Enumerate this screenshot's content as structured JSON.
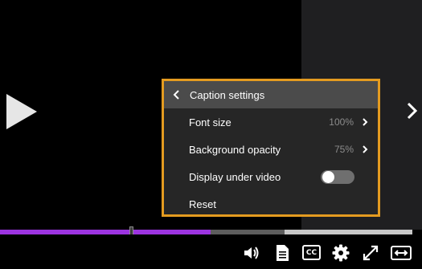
{
  "caption_menu": {
    "title": "Caption settings",
    "items": [
      {
        "label": "Font size",
        "value": "100%"
      },
      {
        "label": "Background opacity",
        "value": "75%"
      }
    ],
    "toggle_row": {
      "label": "Display under video",
      "checked": false
    },
    "reset_label": "Reset"
  },
  "progress": {
    "played_fraction": 0.51,
    "buffered_fraction": 0.69
  },
  "controls": {
    "cc_label": "CC",
    "icons": [
      "volume-icon",
      "transcript-icon",
      "cc-icon",
      "settings-icon",
      "fullscreen-icon",
      "expand-width-icon"
    ]
  },
  "colors": {
    "menu_border": "#e49b20",
    "progress_played": "#9c34e0",
    "menu_header_bg": "#4b4b4b"
  }
}
